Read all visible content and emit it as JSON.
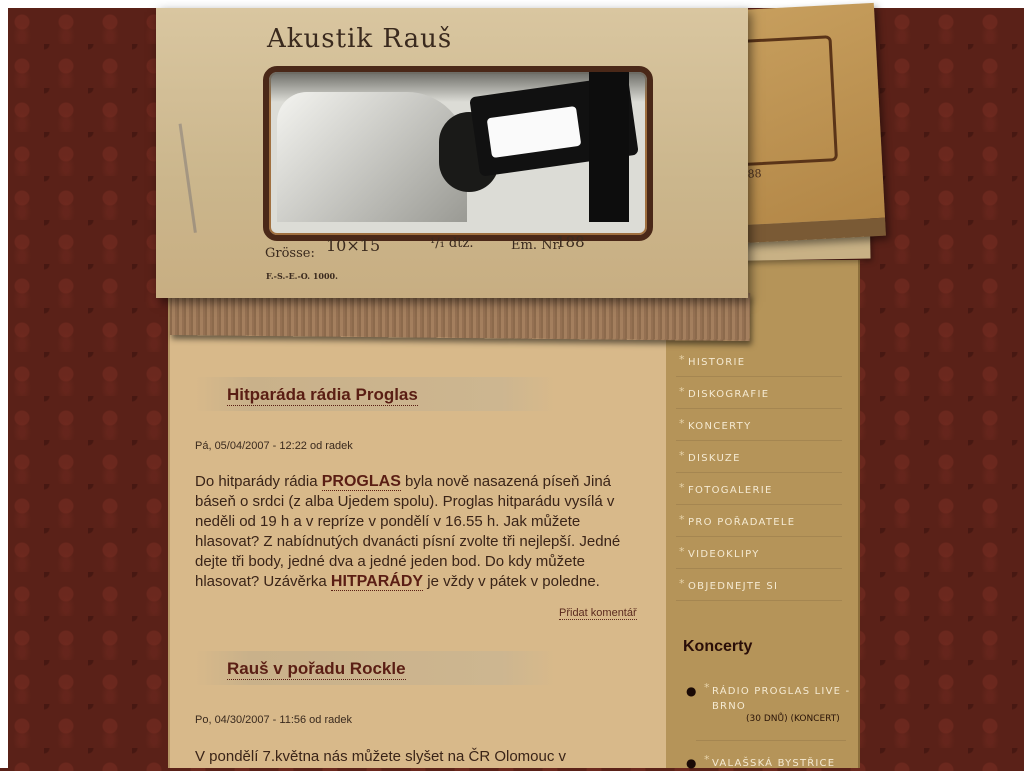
{
  "site": {
    "title": "Akustik Rauš",
    "card": {
      "size_label": "Grösse:",
      "size_value": "10×15",
      "dtz": "¹/₁ dtz.",
      "em_label": "Em. Nr.",
      "em_value": "188",
      "imprint": "F.-S.-E.-O. 1000.",
      "back_number": "188"
    }
  },
  "articles": [
    {
      "title": "Hitparáda rádia Proglas",
      "meta": "Pá, 05/04/2007 - 12:22 od radek",
      "body_before": "Do hitparády rádia ",
      "link1": "PROGLAS",
      "body_middle": " byla nově nasazená píseň Jiná báseň o srdci (z alba Ujedem spolu). Proglas hitparádu vysílá v neděli od 19 h a v repríze v pondělí v 16.55 h. Jak můžete hlasovat? Z nabídnutých dvanácti písní zvolte tři nejlepší. Jedné dejte tři body, jedné dva a jedné jeden bod. Do kdy můžete hlasovat? Uzávěrka ",
      "link2": "HITPARÁDY",
      "body_after": " je vždy v pátek v poledne.",
      "comment_link": "Přidat komentář"
    },
    {
      "title": "Rauš v pořadu Rockle",
      "meta": "Po, 04/30/2007 - 11:56 od radek",
      "body": "V pondělí 7.května nás můžete slyšet na ČR Olomouc v"
    }
  ],
  "nav": {
    "star": "*",
    "items": [
      "HISTORIE",
      "DISKOGRAFIE",
      "KONCERTY",
      "DISKUZE",
      "FOTOGALERIE",
      "PRO POŘADATELE",
      "VIDEOKLIPY",
      "OBJEDNEJTE SI"
    ]
  },
  "sidebar": {
    "concerts_heading": "Koncerty",
    "concerts": [
      {
        "label": "RÁDIO PROGLAS LIVE - BRNO",
        "tags": "(30 DNŮ)  (KONCERT)"
      },
      {
        "label": "VALAŠSKÁ BYSTŘICE",
        "tags": ""
      }
    ]
  },
  "colors": {
    "background": "#5a2118",
    "content": "#d8b98a",
    "sidebar": "#b59459",
    "accent": "#5a1e14"
  }
}
